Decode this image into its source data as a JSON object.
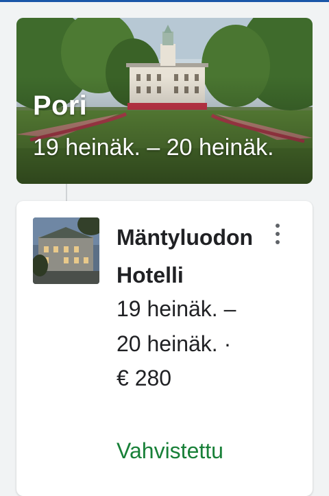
{
  "trip": {
    "city": "Pori",
    "dates": "19 heinäk. – 20 heinäk."
  },
  "reservation": {
    "hotel_name": "Mäntyluodon Hotelli",
    "dates": "19 heinäk. – 20 heinäk. ·",
    "price": "€ 280",
    "status": "Vahvistettu",
    "status_color": "#188038"
  },
  "colors": {
    "accent": "#1a56a8",
    "text": "#202124",
    "icon": "#5f6368"
  },
  "icons": {
    "more": "more-vertical-icon"
  }
}
